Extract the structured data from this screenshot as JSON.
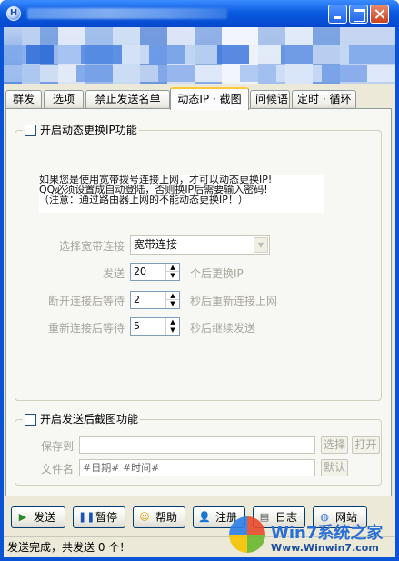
{
  "window": {
    "icon_letter": "H",
    "controls": {
      "minimize": "",
      "maximize": "",
      "close": ""
    }
  },
  "tabs": [
    "群发",
    "选项",
    "禁止发送名单",
    "动态IP · 截图",
    "问候语",
    "定时 · 循环"
  ],
  "active_tab_index": 3,
  "dynamic_ip": {
    "enable_label": "开启动态更换IP功能",
    "enabled": false,
    "info_lines": [
      "如果您是使用宽带拨号连接上网，才可以动态更换IP!",
      "QQ必须设置成自动登陆，否则换IP后需要输入密码!",
      "（注意：通过路由器上网的不能动态更换IP！）"
    ],
    "connection_label": "选择宽带连接",
    "connection_value": "宽带连接",
    "send_label": "发送",
    "send_value": "20",
    "send_suffix": "个后更换IP",
    "disconnect_label": "断开连接后等待",
    "disconnect_value": "2",
    "disconnect_suffix": "秒后重新连接上网",
    "reconnect_label": "重新连接后等待",
    "reconnect_value": "5",
    "reconnect_suffix": "秒后继续发送"
  },
  "screenshot": {
    "enable_label": "开启发送后截图功能",
    "enabled": false,
    "save_to_label": "保存到",
    "save_to_value": "",
    "choose_button": "选择",
    "open_button": "打开",
    "filename_label": "文件名",
    "filename_value": "#日期# #时间#",
    "default_button": "默认"
  },
  "toolbar": {
    "send": "发送",
    "pause": "暂停",
    "help": "帮助",
    "register": "注册",
    "log": "日志",
    "website": "网站"
  },
  "status": "发送完成，共发送 0 个！",
  "watermark": {
    "brand": "Win7系统之家",
    "url": "Www.Winwin7.com"
  },
  "colors": {
    "titlebar": "#0b5be0",
    "tab_highlight": "#ffc83c",
    "panel_bg": "#f7f7f4",
    "disabled_text": "#a7a69c"
  }
}
